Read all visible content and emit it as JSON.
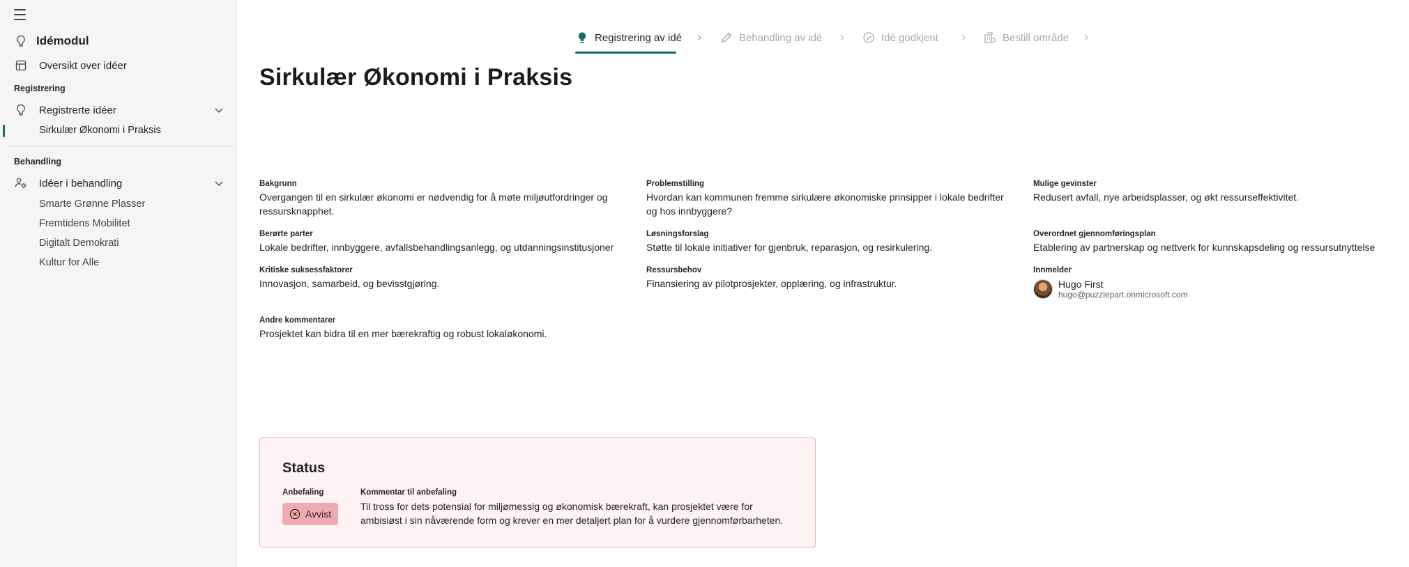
{
  "sidebar": {
    "app_title": "Idémodul",
    "overview": "Oversikt over idéer",
    "section_registration": "Registrering",
    "registered_ideas": "Registrerte idéer",
    "active_item": "Sirkulær Økonomi i Praksis",
    "section_processing": "Behandling",
    "ideas_in_processing": "Idéer i behandling",
    "processing_items": [
      "Smarte Grønne Plasser",
      "Fremtidens Mobilitet",
      "Digitalt Demokrati",
      "Kultur for Alle"
    ]
  },
  "stepper": {
    "steps": [
      {
        "label": "Registrering av idé",
        "state": "active"
      },
      {
        "label": "Behandling av idé",
        "state": "inactive"
      },
      {
        "label": "Idé godkjent",
        "state": "inactive"
      },
      {
        "label": "Bestill område",
        "state": "inactive"
      }
    ]
  },
  "page": {
    "title": "Sirkulær Økonomi i Praksis"
  },
  "fields": {
    "bakgrunn": {
      "label": "Bakgrunn",
      "value": "Overgangen til en sirkulær økonomi er nødvendig for å møte miljøutfordringer og ressursknapphet."
    },
    "problemstilling": {
      "label": "Problemstilling",
      "value": "Hvordan kan kommunen fremme sirkulære økonomiske prinsipper i lokale bedrifter og hos innbyggere?"
    },
    "mulige_gevinster": {
      "label": "Mulige gevinster",
      "value": "Redusert avfall, nye arbeidsplasser, og økt ressurseffektivitet."
    },
    "berorte_parter": {
      "label": "Berørte parter",
      "value": "Lokale bedrifter, innbyggere, avfallsbehandlingsanlegg, og utdanningsinstitusjoner"
    },
    "losningsforslag": {
      "label": "Løsningsforslag",
      "value": "Støtte til lokale initiativer for gjenbruk, reparasjon, og resirkulering."
    },
    "gjennomforingsplan": {
      "label": "Overordnet gjennomføringsplan",
      "value": "Etablering av partnerskap og nettverk for kunnskapsdeling og ressursutnyttelse"
    },
    "suksessfaktorer": {
      "label": "Kritiske suksessfaktorer",
      "value": "Innovasjon, samarbeid, og bevisstgjøring."
    },
    "ressursbehov": {
      "label": "Ressursbehov",
      "value": "Finansiering av pilotprosjekter, opplæring, og infrastruktur."
    },
    "innmelder": {
      "label": "Innmelder",
      "name": "Hugo First",
      "email": "hugo@puzzlepart.onmicrosoft.com"
    },
    "andre_kommentarer": {
      "label": "Andre kommentarer",
      "value": "Prosjektet kan bidra til en mer bærekraftig og robust lokaløkonomi."
    }
  },
  "status": {
    "title": "Status",
    "recommendation_label": "Anbefaling",
    "recommendation_value": "Avvist",
    "comment_label": "Kommentar til anbefaling",
    "comment_value": "Til tross for dets potensial for miljømessig og økonomisk bærekraft, kan prosjektet være for ambisiøst i sin nåværende form og krever en mer detaljert plan for å vurdere gjennomførbarheten."
  },
  "colors": {
    "accent": "#0f6f6f",
    "status_bg": "#fdf3f4",
    "status_border": "#eeacb2"
  },
  "icons": [
    "hamburger-icon",
    "lightbulb-icon",
    "table-icon",
    "chevron-down-icon",
    "people-settings-icon",
    "pencil-icon",
    "checkmark-circle-icon",
    "building-request-icon",
    "chevron-right-icon",
    "dismiss-circle-icon"
  ]
}
